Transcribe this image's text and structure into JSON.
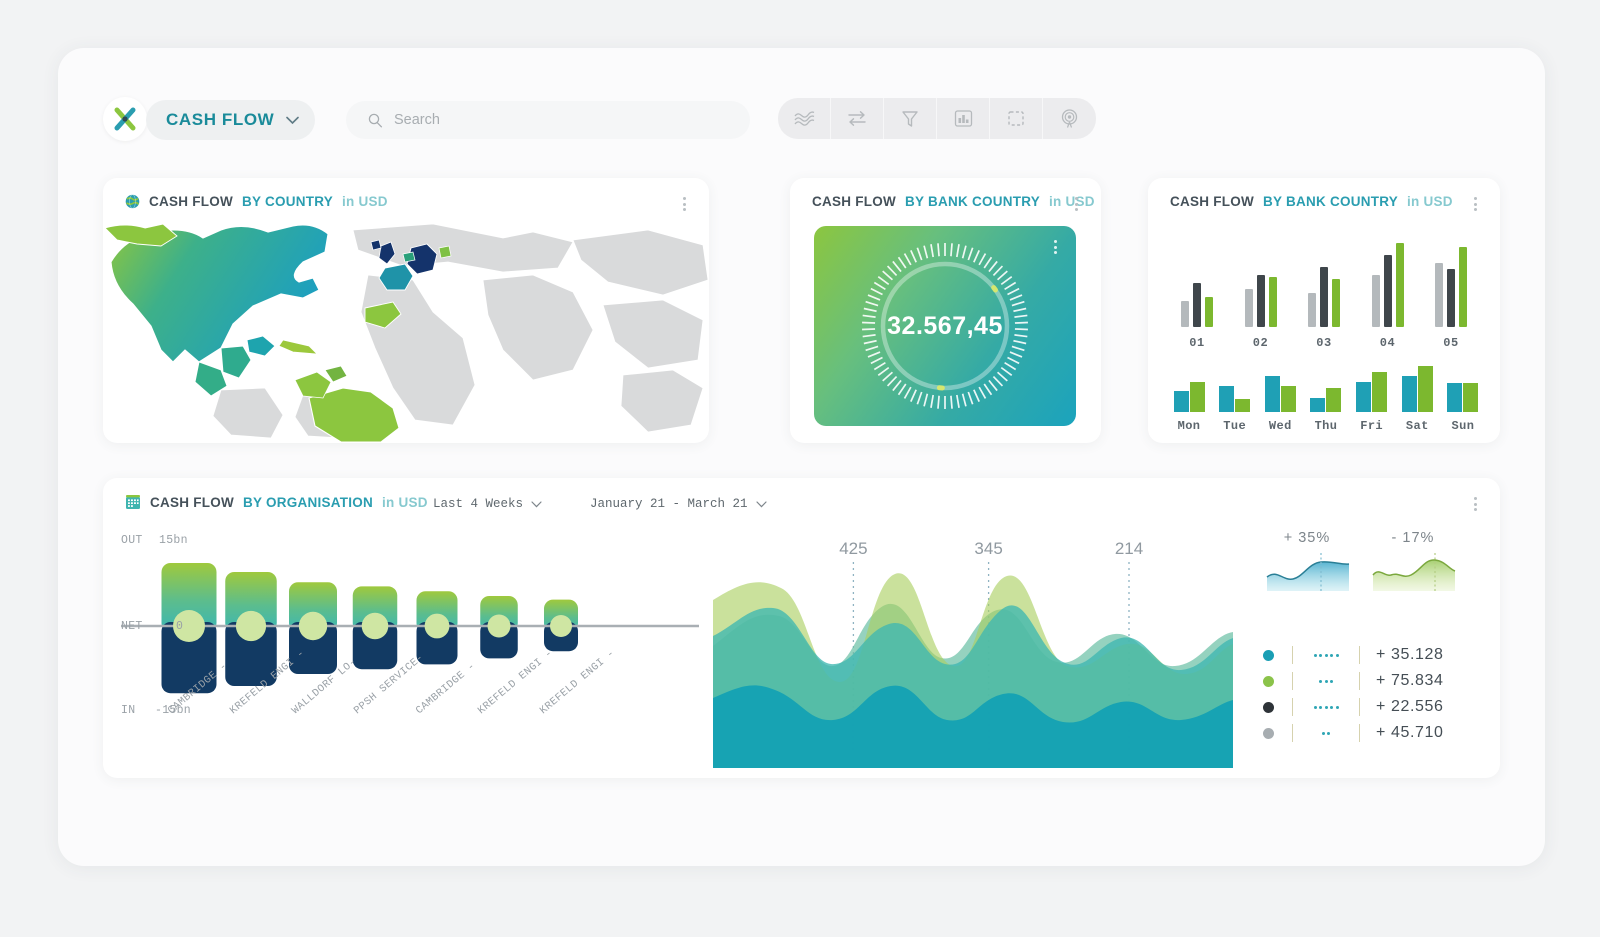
{
  "header": {
    "logo_icon": "x-cross-logo",
    "title": "CASH FLOW",
    "title_chevron_icon": "chevron-down-icon",
    "search": {
      "value": "",
      "placeholder": "Search",
      "icon": "search-icon"
    },
    "toolbar": [
      {
        "name": "trend-line-icon",
        "label": "Trend"
      },
      {
        "name": "exchange-arrows-icon",
        "label": "Transfers"
      },
      {
        "name": "filter-funnel-icon",
        "label": "Filter"
      },
      {
        "name": "bar-chart-icon",
        "label": "Chart"
      },
      {
        "name": "dashed-square-icon",
        "label": "Select Area"
      },
      {
        "name": "radar-target-icon",
        "label": "Radar"
      }
    ]
  },
  "cards": {
    "map": {
      "icon": "globe-icon",
      "title_main": "CASH FLOW",
      "title_by": "BY COUNTRY",
      "title_currency": "in USD",
      "menu_icon": "kebab-menu-icon"
    },
    "gauge": {
      "title_main": "CASH FLOW",
      "title_by": "BY BANK COUNTRY",
      "title_currency": "in USD",
      "menu_icon": "kebab-menu-icon",
      "value": "32.567,45",
      "tile_menu_icon": "kebab-menu-icon"
    },
    "bars": {
      "title_main": "CASH FLOW",
      "title_by": "BY BANK COUNTRY",
      "title_currency": "in USD",
      "menu_icon": "kebab-menu-icon"
    },
    "org": {
      "icon": "building-chart-icon",
      "title_main": "CASH FLOW",
      "title_by": "BY ORGANISATION",
      "title_currency": "in USD",
      "menu_icon": "kebab-menu-icon",
      "filter_period": "Last 4 Weeks",
      "filter_period_icon": "chevron-down-icon",
      "filter_range": "January 21 - March 21",
      "filter_range_icon": "chevron-down-icon"
    }
  },
  "chart_data": [
    {
      "id": "bank-country-monthly",
      "type": "bar",
      "title": "CASH FLOW BY BANK COUNTRY in USD",
      "categories": [
        "01",
        "02",
        "03",
        "04",
        "05"
      ],
      "series": [
        {
          "name": "light-gray",
          "color": "#b4b9bc",
          "values": [
            26,
            38,
            34,
            52,
            64
          ]
        },
        {
          "name": "dark-gray",
          "color": "#3f464b",
          "values": [
            44,
            52,
            60,
            72,
            58
          ]
        },
        {
          "name": "green",
          "color": "#7cb82f",
          "values": [
            30,
            50,
            48,
            84,
            80
          ]
        }
      ],
      "ylim": [
        0,
        88
      ],
      "grid": false,
      "legend": "none"
    },
    {
      "id": "bank-country-weekday",
      "type": "bar",
      "title": "CASH FLOW BY BANK COUNTRY in USD",
      "categories": [
        "Mon",
        "Tue",
        "Wed",
        "Thu",
        "Fri",
        "Sat",
        "Sun"
      ],
      "series": [
        {
          "name": "teal",
          "color": "#1fa0b5",
          "values": [
            22,
            27,
            38,
            15,
            31,
            37,
            30
          ]
        },
        {
          "name": "green",
          "color": "#7cb82f",
          "values": [
            31,
            14,
            27,
            25,
            42,
            48,
            30
          ]
        }
      ],
      "ylim": [
        0,
        50
      ],
      "grid": false,
      "legend": "none"
    },
    {
      "id": "cash-flow-by-organisation-waterfall",
      "type": "bar",
      "title": "CASH FLOW BY ORGANISATION in USD",
      "xlabel": "",
      "ylabel": "",
      "axis_labels": [
        {
          "tag": "OUT",
          "value": "15bn"
        },
        {
          "tag": "NET",
          "value": "0"
        },
        {
          "tag": "IN",
          "value": "-15bn"
        }
      ],
      "ylim": [
        -15,
        15
      ],
      "categories": [
        "CAMBRIDGE -",
        "KREFELD ENGI -",
        "WALLDORF LO-",
        "PPSH SERVICE-",
        "CAMBRIDGE -",
        "KREFELD ENGI -",
        "KREFELD ENGI -"
      ],
      "series": [
        {
          "name": "OUT",
          "values": [
            10.5,
            9.0,
            7.3,
            6.6,
            5.8,
            5.0,
            4.4
          ]
        },
        {
          "name": "IN",
          "values": [
            -11.2,
            -10.0,
            -8.0,
            -7.2,
            -6.4,
            -5.4,
            -4.2
          ]
        }
      ],
      "grid": false,
      "legend": "none"
    },
    {
      "id": "cash-flow-stream",
      "type": "area",
      "stacked": false,
      "annotations": [
        {
          "label": "425",
          "x_pct": 27
        },
        {
          "label": "345",
          "x_pct": 53
        },
        {
          "label": "214",
          "x_pct": 80
        }
      ],
      "series": [
        {
          "name": "layer-bottom",
          "color": "#12a0b4"
        },
        {
          "name": "layer-middle",
          "color": "#3fb7ae"
        },
        {
          "name": "layer-top",
          "color": "#a9ce5f"
        }
      ],
      "grid": false,
      "legend": "none"
    },
    {
      "id": "sparkline-positive",
      "type": "area",
      "title": "+ 35%",
      "color": "#2a9fc4"
    },
    {
      "id": "sparkline-negative",
      "type": "area",
      "title": "- 17%",
      "color": "#8ec24a"
    }
  ],
  "stats": {
    "sparklines": [
      {
        "label": "+ 35%",
        "color": "#2a9fc4"
      },
      {
        "label": "- 17%",
        "color": "#8ec24a"
      }
    ],
    "legend_rows": [
      {
        "dot_color": "#1a9eb4",
        "dots": 5,
        "value": "+ 35.128"
      },
      {
        "dot_color": "#8bc34a",
        "dots": 3,
        "value": "+ 75.834"
      },
      {
        "dot_color": "#2e3338",
        "dots": 5,
        "value": "+ 22.556"
      },
      {
        "dot_color": "#a7adb1",
        "dots": 2,
        "value": "+ 45.710"
      }
    ]
  }
}
